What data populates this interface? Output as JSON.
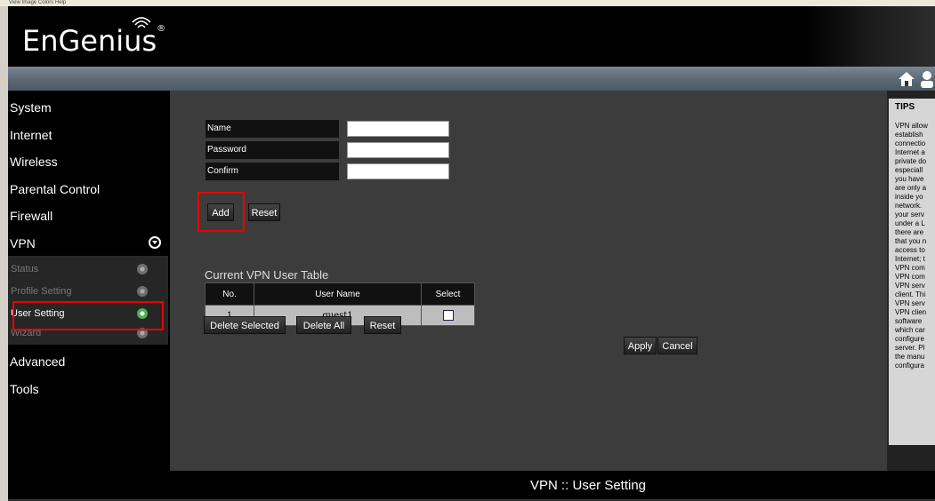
{
  "os_menu": {
    "text": "View   Image   Colors   Help"
  },
  "header": {
    "logo_text": "EnGenius",
    "logo_mark": "®"
  },
  "sidebar": {
    "items": [
      {
        "label": "System"
      },
      {
        "label": "Internet"
      },
      {
        "label": "Wireless"
      },
      {
        "label": "Parental Control"
      },
      {
        "label": "Firewall"
      },
      {
        "label": "VPN"
      },
      {
        "label": "Advanced"
      },
      {
        "label": "Tools"
      }
    ],
    "vpn_sub": [
      {
        "label": "Status"
      },
      {
        "label": "Profile Setting"
      },
      {
        "label": "User Setting"
      },
      {
        "label": "Wizard"
      }
    ]
  },
  "form": {
    "name_label": "Name",
    "password_label": "Password",
    "confirm_label": "Confirm",
    "name_value": "",
    "password_value": "",
    "confirm_value": "",
    "add_label": "Add",
    "reset_label": "Reset"
  },
  "table": {
    "title": "Current VPN User Table",
    "headers": [
      "No.",
      "User Name",
      "Select"
    ],
    "rows": [
      {
        "no": "1",
        "user": "guest1"
      }
    ],
    "delete_selected_label": "Delete Selected",
    "delete_all_label": "Delete All",
    "reset_label": "Reset"
  },
  "actions": {
    "apply_label": "Apply",
    "cancel_label": "Cancel"
  },
  "footer": {
    "title": "VPN :: User Setting"
  },
  "tips": {
    "title": "TIPS",
    "text": "VPN allow\nestablish\nconnectio\nInternet a\nprivate do\nespeciall\nyou have\nare only a\ninside yo\nnetwork.\nyour serv\nunder a L\nthere are\nthat you n\naccess to\nInternet; t\nVPN com\nVPN com\nVPN serv\nclient. Thi\nVPN serv\nVPN clien\nsoftware\nwhich car\nconfigure\nserver. Pl\nthe manu\nconfigura"
  },
  "colors": {
    "accent_red": "#e00000",
    "active_green": "#4caf50"
  }
}
